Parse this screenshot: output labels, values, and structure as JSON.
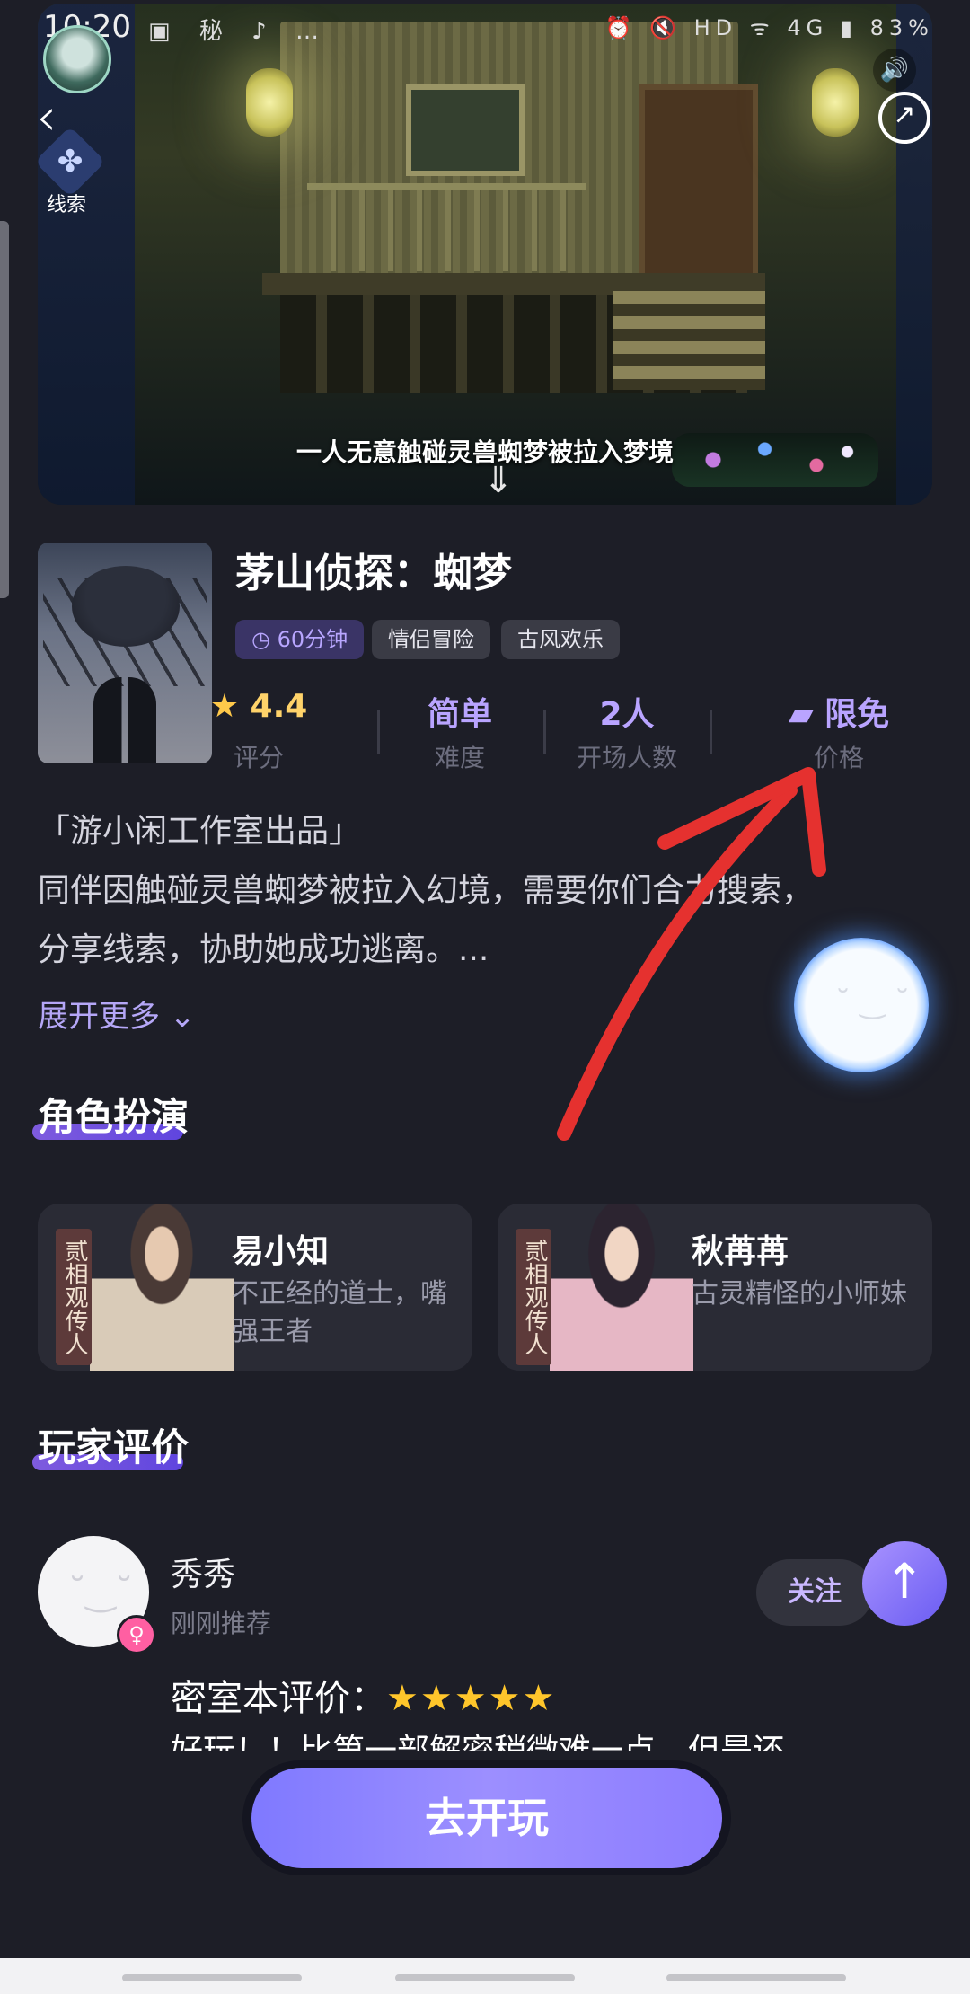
{
  "status_bar": {
    "time": "10:20",
    "icons_left": "▣ 秘 ♪ …",
    "icons_right": "⏰ 🔇 HD ᯤ 4G ▮ 83%"
  },
  "banner": {
    "subtitle": "一人无意触碰灵兽蜘梦被拉入梦境",
    "clue_label": "线索"
  },
  "game": {
    "title": "茅山侦探：蜘梦",
    "tags": [
      "60分钟",
      "情侣冒险",
      "古风欢乐"
    ],
    "stats": [
      {
        "value": "4.4",
        "label": "评分"
      },
      {
        "value": "简单",
        "label": "难度"
      },
      {
        "value": "2人",
        "label": "开场人数"
      },
      {
        "value": "限免",
        "label": "价格"
      }
    ],
    "description": [
      "「游小闲工作室出品」",
      "同伴因触碰灵兽蜘梦被拉入幻境，需要你们合力搜索，",
      "分享线索，协助她成功逃离。..."
    ],
    "expand_label": "展开更多"
  },
  "roles_section": {
    "title": "角色扮演",
    "roles": [
      {
        "tag": "贰相观传人",
        "name": "易小知",
        "desc": "不正经的道士，嘴强王者"
      },
      {
        "tag": "贰相观传人",
        "name": "秋苒苒",
        "desc": "古灵精怪的小师妹"
      }
    ]
  },
  "reviews_section": {
    "title": "玩家评价",
    "review": {
      "name": "秀秀",
      "meta": "刚刚推荐",
      "follow_label": "关注",
      "score_label": "密室本评价：",
      "rating": 5,
      "stars": "★★★★★",
      "text": "好玩！！比第一部解密稍微难一点，但是还"
    }
  },
  "cta": {
    "play_label": "去开玩"
  },
  "colors": {
    "background": "#1d1e27",
    "accent": "#b9a4ff",
    "play_button": "#8c84ff",
    "star": "#ffc62b",
    "annotation": "#e5312f"
  }
}
